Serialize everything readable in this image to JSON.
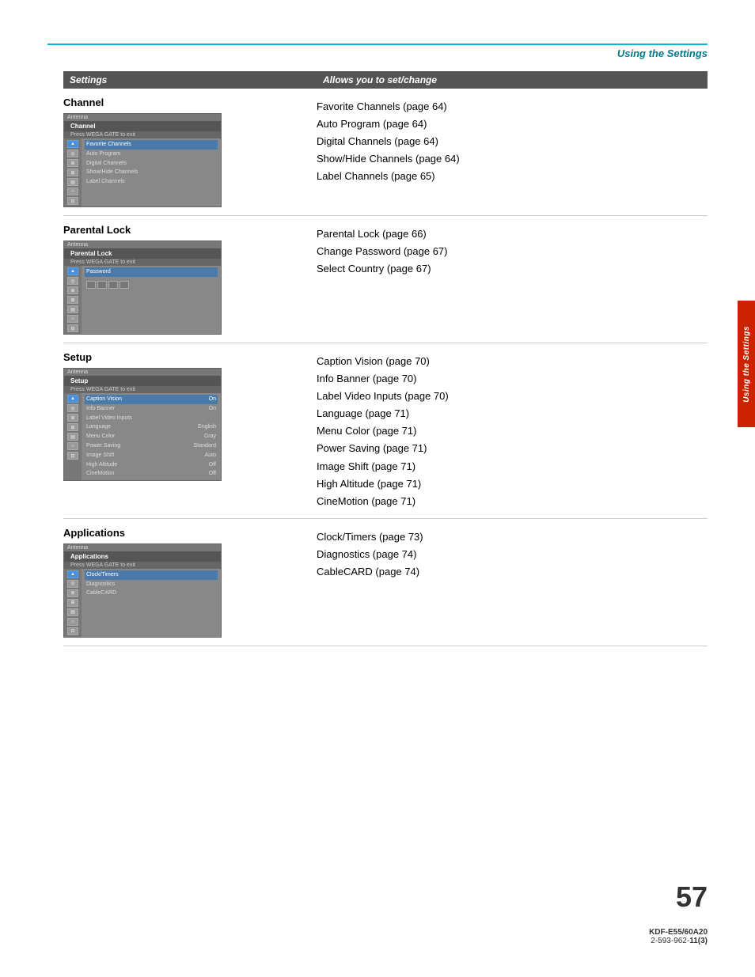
{
  "page": {
    "title": "Using the Settings",
    "page_number": "57",
    "model": "KDF-E55/60A20",
    "part_number_prefix": "2-593-962-",
    "part_number_suffix": "11(3)"
  },
  "table": {
    "col1_header": "Settings",
    "col2_header": "Allows you to set/change"
  },
  "sections": [
    {
      "id": "channel",
      "title": "Channel",
      "menu_title": "Channel",
      "menu_subtitle": "Press WEGA GATE to exit",
      "antenna_label": "Antenna",
      "items": [
        "Favorite Channels",
        "Auto Program",
        "Digital Channels",
        "Show/Hide Channels",
        "Label Channels"
      ],
      "allows": [
        "Favorite Channels (page 64)",
        "Auto Program (page 64)",
        "Digital Channels (page 64)",
        "Show/Hide Channels (page 64)",
        "Label Channels (page 65)"
      ]
    },
    {
      "id": "parental-lock",
      "title": "Parental Lock",
      "menu_title": "Parental Lock",
      "menu_subtitle": "Press WEGA GATE to exit",
      "antenna_label": "Antenna",
      "items": [
        "Password"
      ],
      "allows": [
        "Parental Lock (page 66)",
        "Change Password (page 67)",
        "Select Country (page 67)"
      ]
    },
    {
      "id": "setup",
      "title": "Setup",
      "menu_title": "Setup",
      "menu_subtitle": "Press WEGA GATE to exit",
      "antenna_label": "Antenna",
      "items": [
        {
          "label": "Caption Vision",
          "value": "On"
        },
        {
          "label": "Info Banner",
          "value": "On"
        },
        {
          "label": "Label Video Inputs",
          "value": ""
        },
        {
          "label": "Language",
          "value": "English"
        },
        {
          "label": "Menu Color",
          "value": "Gray"
        },
        {
          "label": "Power Saving",
          "value": "Standard"
        },
        {
          "label": "Image Shift",
          "value": "Auto"
        },
        {
          "label": "High Altitude",
          "value": "Off"
        },
        {
          "label": "CineMotion",
          "value": "Off"
        }
      ],
      "allows": [
        "Caption Vision (page 70)",
        "Info Banner (page 70)",
        "Label Video Inputs (page 70)",
        "Language (page 71)",
        "Menu Color (page 71)",
        "Power Saving (page 71)",
        "Image Shift (page 71)",
        "High Altitude (page 71)",
        "CineMotion (page 71)"
      ]
    },
    {
      "id": "applications",
      "title": "Applications",
      "menu_title": "Applications",
      "menu_subtitle": "Press WEGA GATE to exit",
      "antenna_label": "Antenna",
      "items": [
        "Clock/Timers",
        "Diagnostics",
        "CableCARD"
      ],
      "allows": [
        "Clock/Timers (page 73)",
        "Diagnostics (page 74)",
        "CableCARD (page 74)"
      ]
    }
  ],
  "side_tab_text": "Using the Settings"
}
